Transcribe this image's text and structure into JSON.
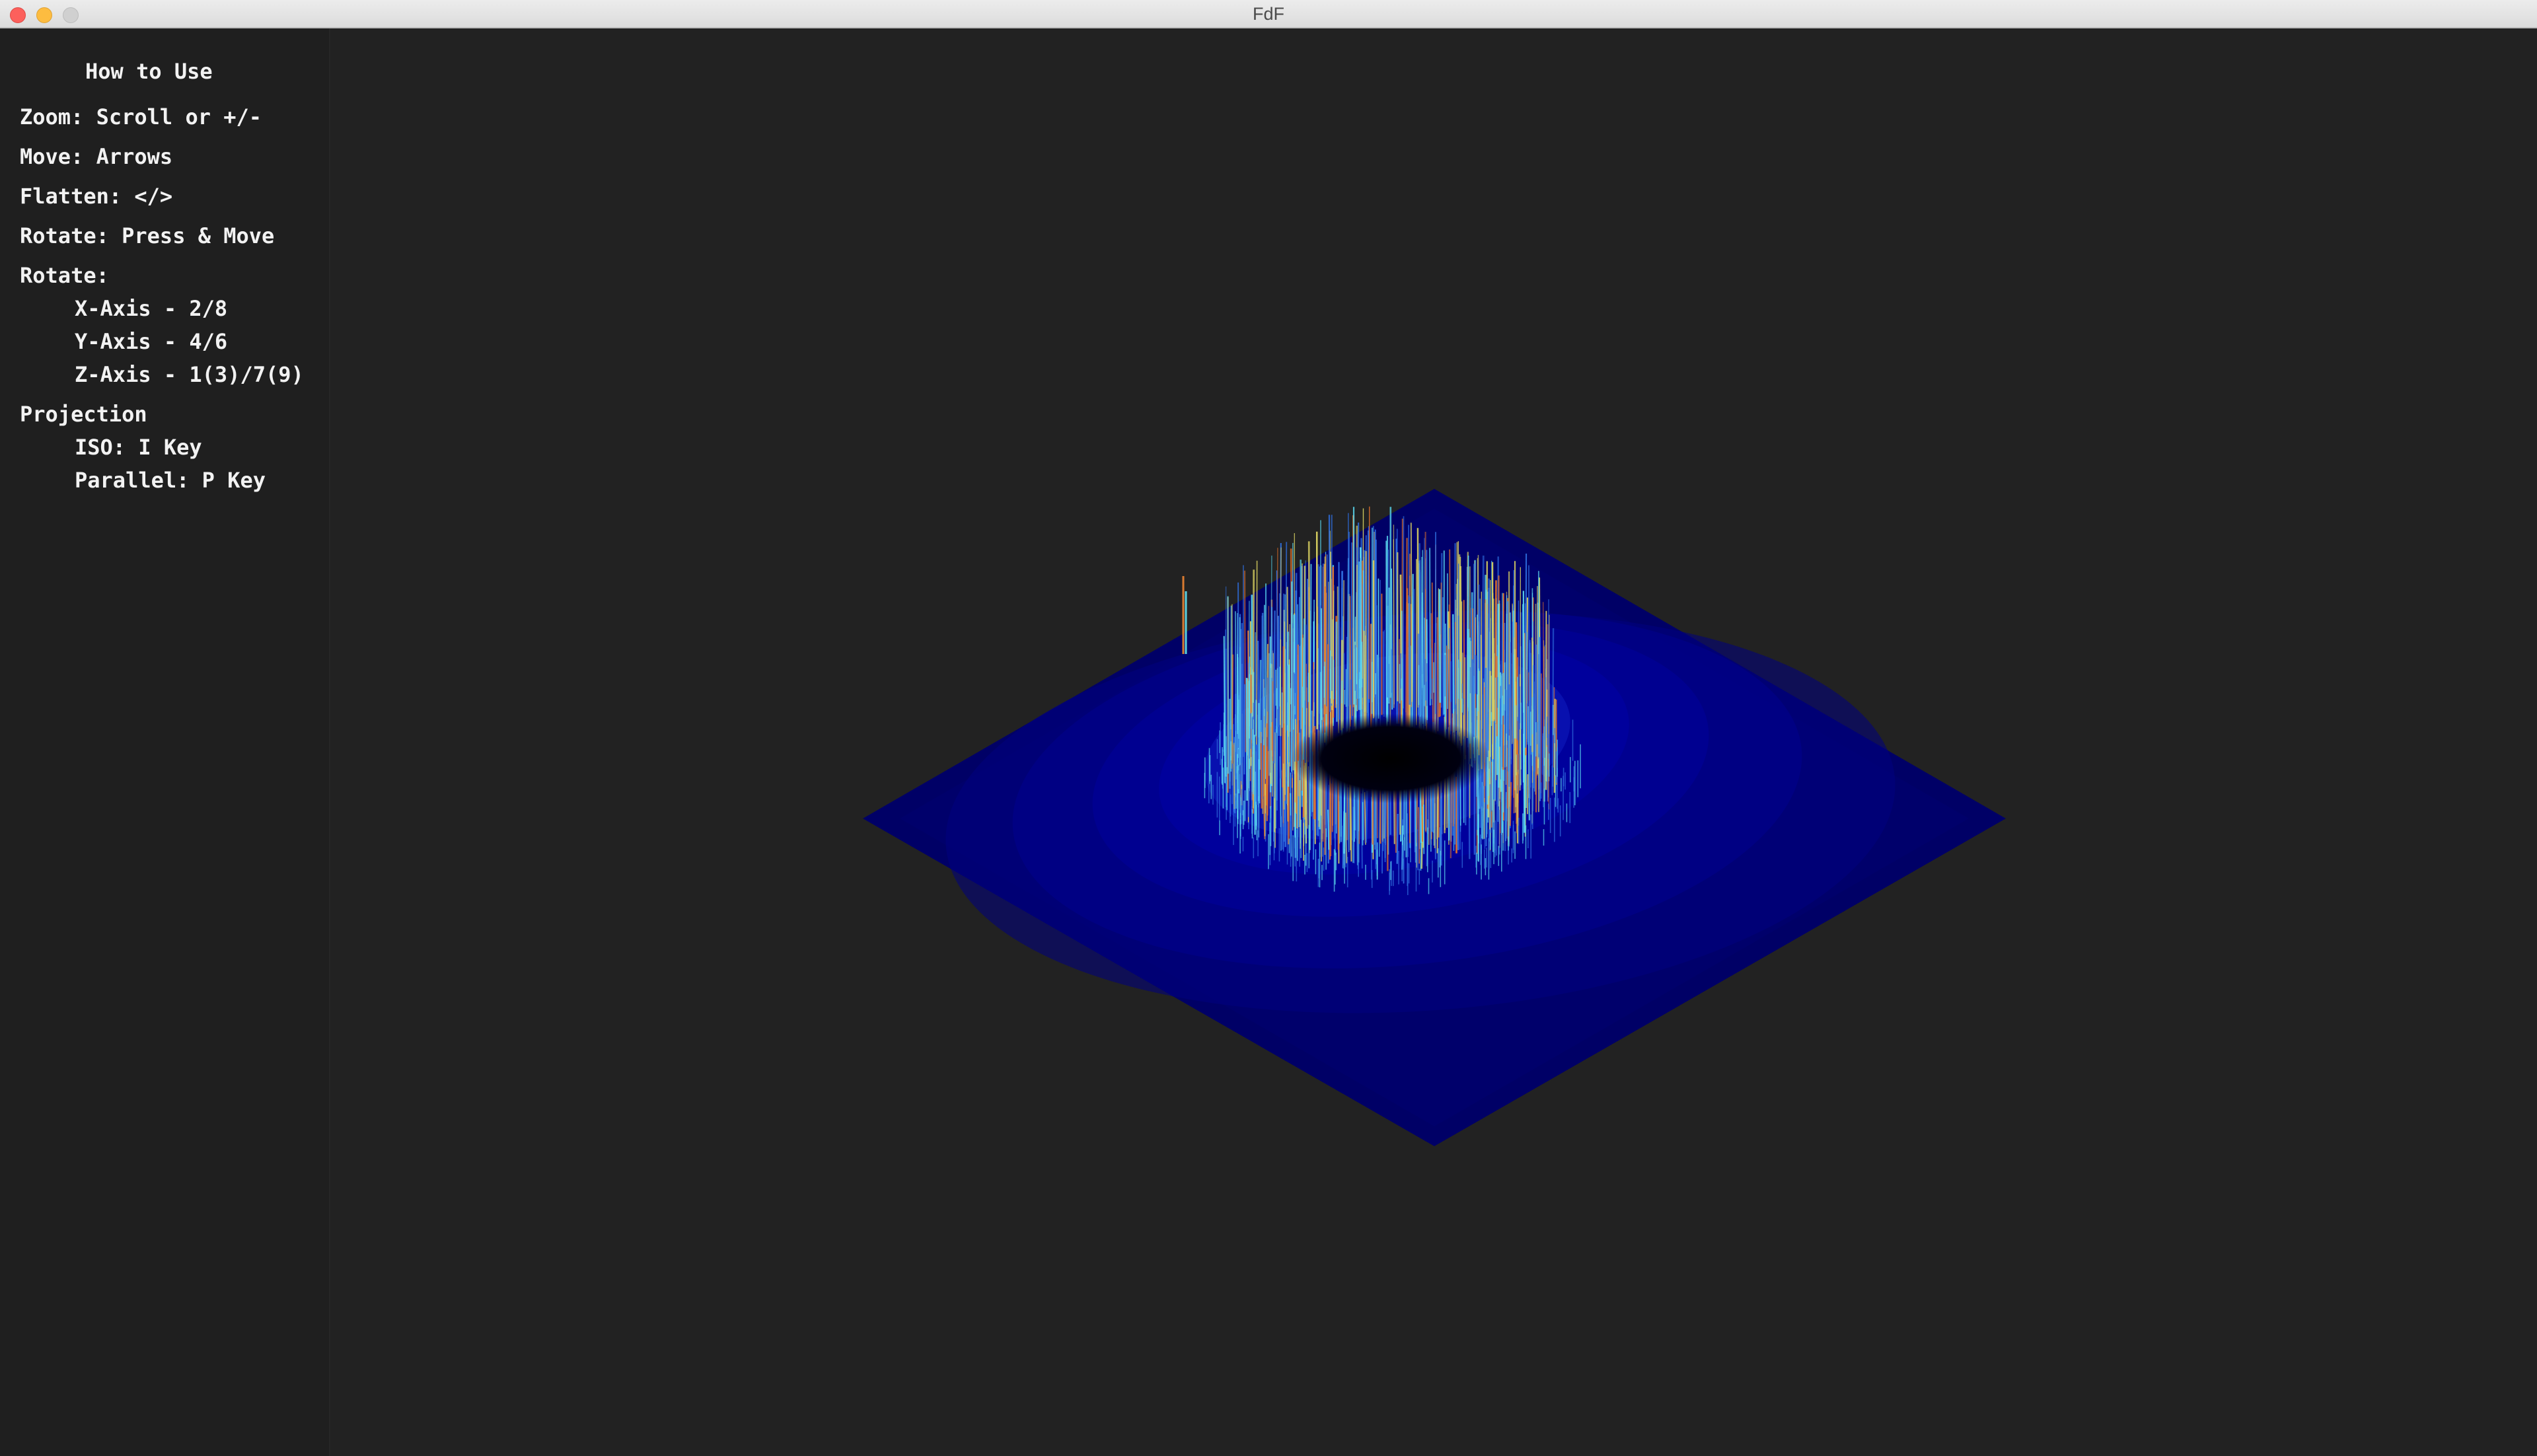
{
  "window": {
    "title": "FdF"
  },
  "help": {
    "heading": "How to Use",
    "zoom": "Zoom: Scroll or +/-",
    "move": "Move: Arrows",
    "flatten": "Flatten: </>",
    "rotate_mouse": "Rotate: Press & Move",
    "rotate_keys": "Rotate:",
    "x_axis": "X-Axis - 2/8",
    "y_axis": "Y-Axis - 4/6",
    "z_axis": "Z-Axis - 1(3)/7(9)",
    "projection": "Projection",
    "iso": "ISO: I Key",
    "parallel": "Parallel: P Key"
  },
  "render": {
    "projection": "isometric",
    "colors": {
      "background": "#222222",
      "sidebar": "#1f1f1f",
      "low": "#00007a",
      "mid": "#2f6fe0",
      "cyan": "#5ad8f0",
      "high_yellow": "#d8d060",
      "peak_orange": "#e0702a",
      "hole": "#000000"
    }
  }
}
